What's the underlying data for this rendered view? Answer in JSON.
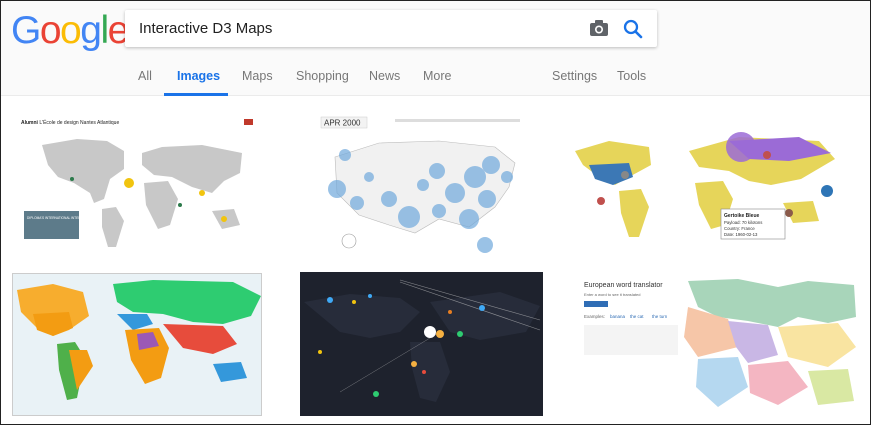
{
  "logo": {
    "text": "Google"
  },
  "search": {
    "value": "Interactive D3 Maps"
  },
  "tabs": {
    "all": "All",
    "images": "Images",
    "maps": "Maps",
    "shopping": "Shopping",
    "news": "News",
    "more": "More",
    "settings": "Settings",
    "tools": "Tools"
  },
  "results": [
    {
      "title": "Alumni",
      "subtitle": "L'École de design Nantes Atlantique",
      "box": "DIPLOMA'S INTERNATIONAL INTERNSHIPS"
    },
    {
      "date": "APR 2000"
    },
    {
      "tooltip": {
        "name": "Gertoike Bleue",
        "line1": "Payload: 70 kilotons",
        "line2": "Country: France",
        "line3": "Date: 1960-02-13"
      }
    },
    {},
    {},
    {
      "title": "European word translator",
      "text": "Enter a word to see it translated",
      "examples": "Examples:",
      "ex1": "banana",
      "ex2": "the cat",
      "ex3": "the turn"
    }
  ],
  "colors": {
    "accent": "#1a73e8",
    "blue": "#4285F4",
    "red": "#EA4335",
    "yellow": "#FBBC05",
    "green": "#34A853"
  }
}
